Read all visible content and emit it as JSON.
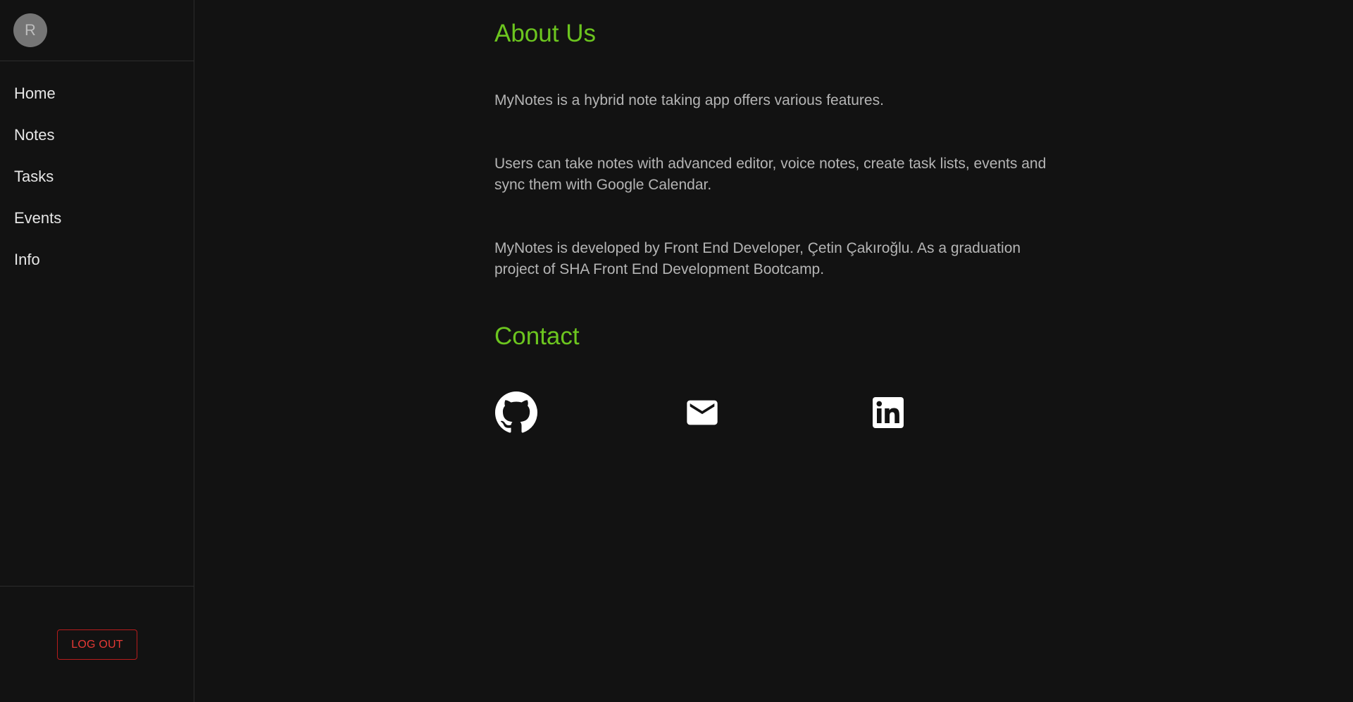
{
  "sidebar": {
    "avatar_initial": "R",
    "nav_items": [
      {
        "label": "Home"
      },
      {
        "label": "Notes"
      },
      {
        "label": "Tasks"
      },
      {
        "label": "Events"
      },
      {
        "label": "Info"
      }
    ],
    "logout_label": "LOG OUT"
  },
  "main": {
    "about_heading": "About Us",
    "paragraphs": [
      "MyNotes is a hybrid note taking app offers various features.",
      "Users can take notes with advanced editor, voice notes, create task lists, events and sync them with Google Calendar.",
      "MyNotes is developed by Front End Developer, Çetin Çakıroğlu. As a graduation project of SHA Front End Development Bootcamp."
    ],
    "contact_heading": "Contact",
    "contact_icons": [
      {
        "icon": "github-icon"
      },
      {
        "icon": "mail-icon"
      },
      {
        "icon": "linkedin-icon"
      }
    ]
  },
  "colors": {
    "background": "#121212",
    "accent_green": "#6cc51f",
    "logout_red": "#e53935",
    "text_gray": "#b5b5b5"
  }
}
